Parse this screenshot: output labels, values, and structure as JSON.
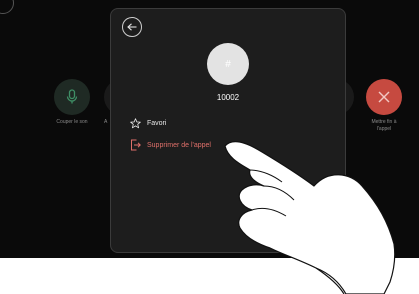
{
  "header": {
    "ghost_text": ""
  },
  "call_controls": {
    "mute_label": "Couper le son",
    "partial_label": "A",
    "end_label_line1": "Mettre fin à",
    "end_label_line2": "l'appel"
  },
  "contact": {
    "avatar_glyph": "#",
    "number": "10002"
  },
  "menu": {
    "favorite_label": "Favori",
    "remove_label": "Supprimer de l'appel"
  },
  "colors": {
    "end_call": "#c64a40",
    "remove_text": "#e0706a",
    "mute_icon": "#2e6b4f"
  },
  "icons": {
    "back": "arrow-left-icon",
    "favorite": "star-outline-icon",
    "remove": "exit-door-icon",
    "mute": "microphone-icon",
    "end_call": "close-icon"
  }
}
